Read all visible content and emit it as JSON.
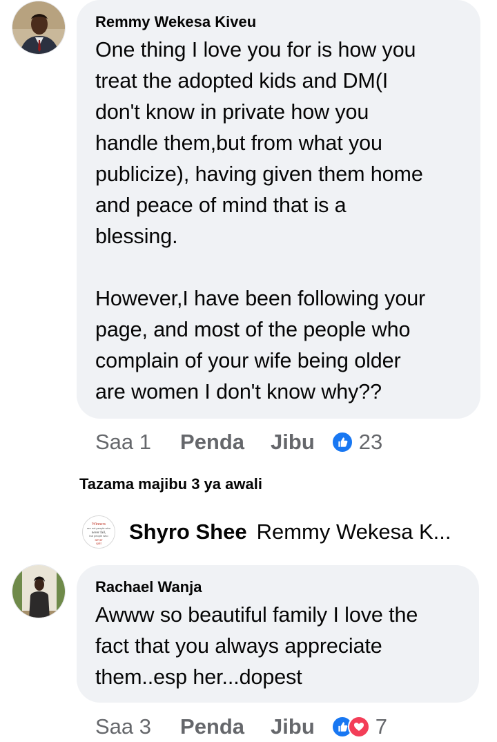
{
  "comments": [
    {
      "author": "Remmy Wekesa Kiveu",
      "text": "One thing I love you for is how you\ntreat the adopted kids and DM(I\ndon't know in private how you\nhandle them,but from what you\npublicize), having given them home\nand peace of mind that is a\nblessing.\n\nHowever,I have been following your\npage, and most of the people who\ncomplain of your wife being older\nare women I don't know why??",
      "time": "Saa 1",
      "like_label": "Penda",
      "reply_label": "Jibu",
      "reactions": [
        "like-icon"
      ],
      "reaction_count": "23"
    },
    {
      "author": "Rachael Wanja",
      "text": "Awww so beautiful family I love the\nfact that you always appreciate\nthem..esp her...dopest",
      "time": "Saa 3",
      "like_label": "Penda",
      "reply_label": "Jibu",
      "reactions": [
        "like-icon",
        "love-icon"
      ],
      "reaction_count": "7"
    }
  ],
  "replies": {
    "view_more_label": "Tazama majibu 3 ya awali",
    "preview": {
      "author": "Shyro Shee",
      "text": "Remmy Wekesa K...",
      "avatar_text": "Winners are not people who never fail, but people who never quit"
    }
  },
  "colors": {
    "bubble": "#f0f2f5",
    "meta_text": "#65676b",
    "like_blue": "#1877f2",
    "love_red": "#f33e58"
  }
}
